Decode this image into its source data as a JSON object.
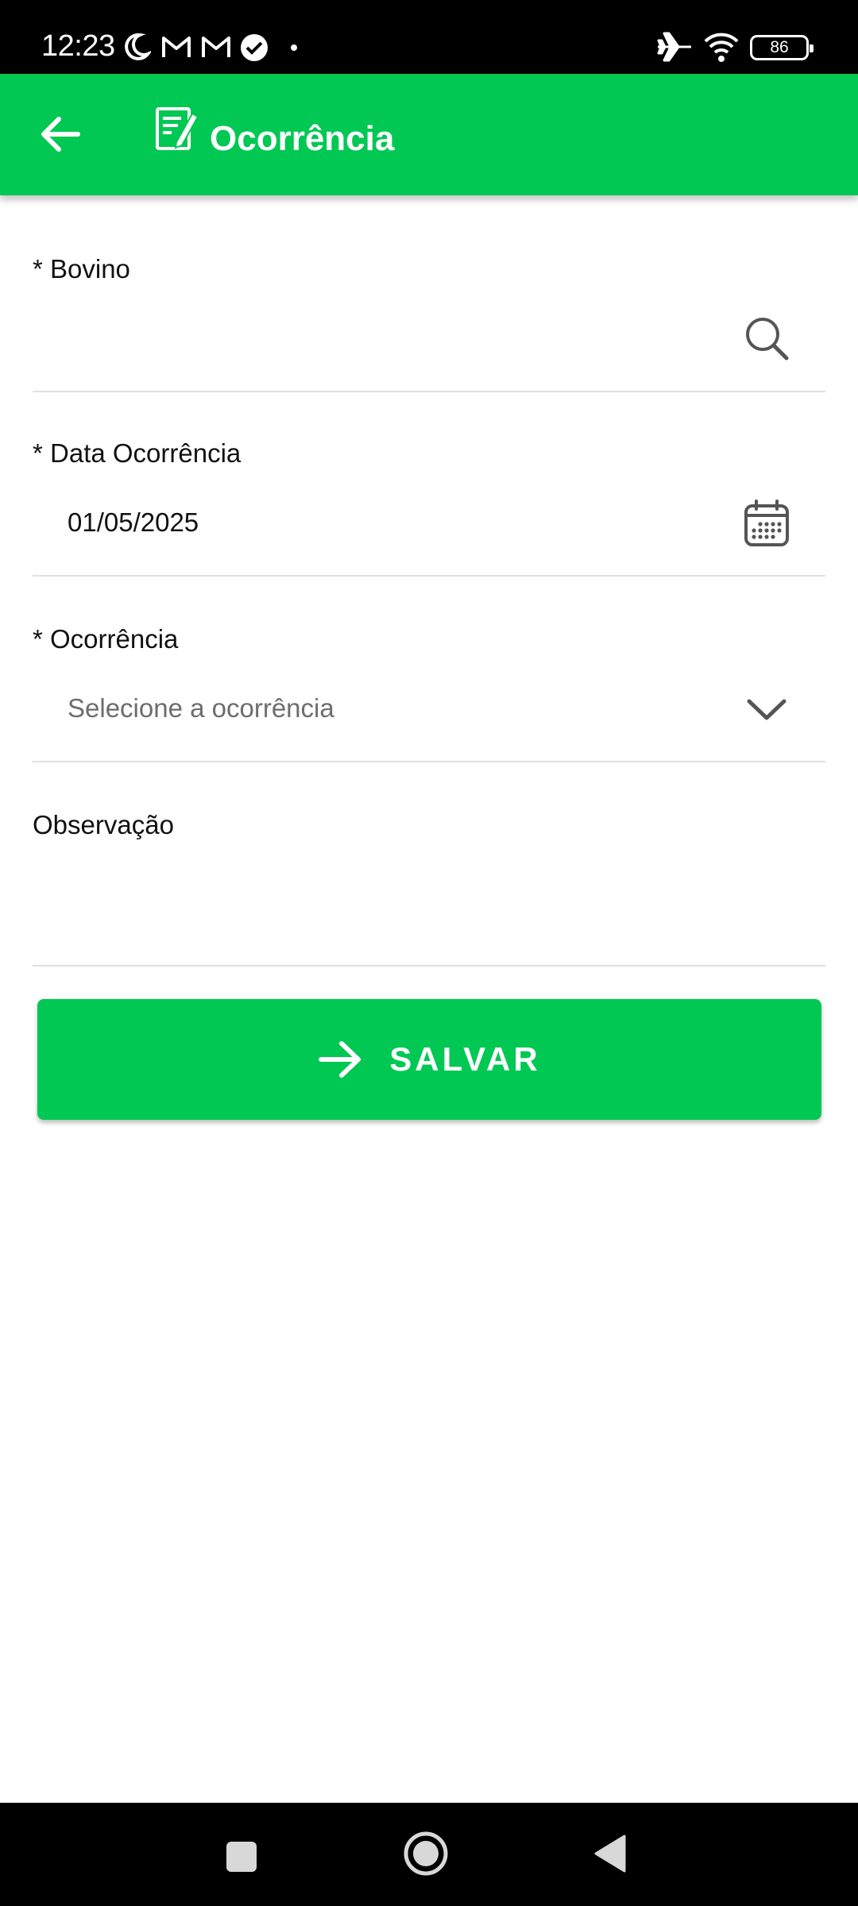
{
  "status_bar": {
    "time": "12:23",
    "battery": "86",
    "icons": [
      "moon-icon",
      "gmail-icon",
      "gmail-icon",
      "check-circle-icon",
      "dot-icon",
      "airplane-icon",
      "wifi-icon",
      "battery-icon"
    ]
  },
  "app_bar": {
    "title": "Ocorrência",
    "back_icon": "arrow-left-icon",
    "title_icon": "edit-note-icon",
    "background": "#00c853"
  },
  "form": {
    "bovino": {
      "label": "* Bovino",
      "value": "",
      "icon": "search-icon"
    },
    "data_ocorrencia": {
      "label": "* Data Ocorrência",
      "value": "01/05/2025",
      "icon": "calendar-icon"
    },
    "ocorrencia": {
      "label": "* Ocorrência",
      "placeholder": "Selecione a ocorrência",
      "icon": "chevron-down-icon"
    },
    "observacao": {
      "label": "Observação",
      "value": ""
    }
  },
  "save_button": {
    "label": "SALVAR",
    "icon": "arrow-right-icon",
    "color": "#00c853"
  },
  "nav_bar": {
    "buttons": [
      "recents-button",
      "home-button",
      "back-button"
    ]
  }
}
